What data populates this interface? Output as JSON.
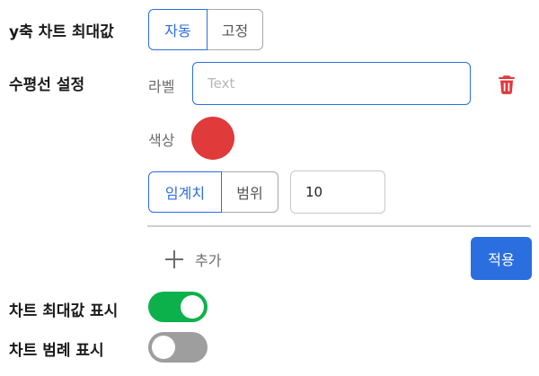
{
  "colors": {
    "accent": "#2b6ee0",
    "danger": "#e0393e",
    "toggle_on": "#0db14b",
    "toggle_off": "#9e9e9e",
    "swatch": "#e03a3a"
  },
  "y_axis_max": {
    "label": "y축 차트 최대값",
    "options": [
      "자동",
      "고정"
    ],
    "selected": "자동"
  },
  "horizontal_line": {
    "label": "수평선 설정",
    "label_field_label": "라벨",
    "label_field_placeholder": "Text",
    "label_field_value": "",
    "delete_icon": "trash-icon",
    "color_label": "색상",
    "color_value": "#e03a3a",
    "mode_options": [
      "임계치",
      "범위"
    ],
    "mode_selected": "임계치",
    "threshold_value": "10",
    "add_label": "추가",
    "add_icon": "plus-icon",
    "apply_label": "적용"
  },
  "show_chart_max": {
    "label": "차트 최대값 표시",
    "enabled": true
  },
  "show_chart_legend": {
    "label": "차트 범례 표시",
    "enabled": false
  }
}
